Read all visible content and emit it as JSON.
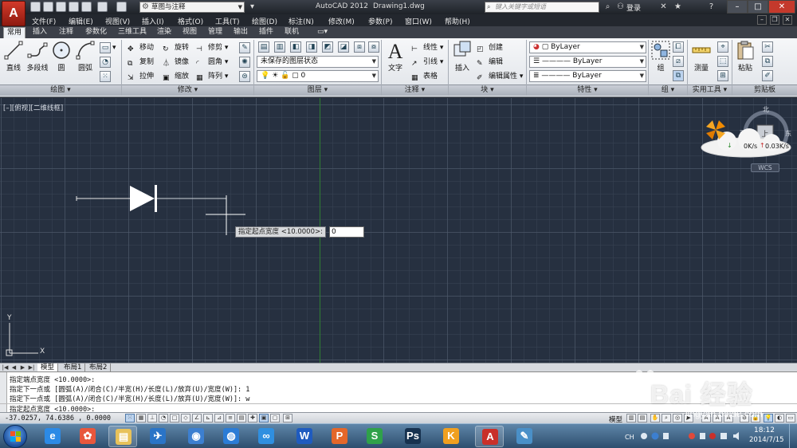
{
  "titlebar": {
    "app_logo": "A",
    "workspace": "草图与注释",
    "app_title": "AutoCAD 2012",
    "file_title": "Drawing1.dwg",
    "search_placeholder": "键入关键字或短语",
    "login": "登录",
    "minimize": "–",
    "maximize": "□",
    "close": "✕"
  },
  "menubar": {
    "items": [
      "文件(F)",
      "编辑(E)",
      "视图(V)",
      "插入(I)",
      "格式(O)",
      "工具(T)",
      "绘图(D)",
      "标注(N)",
      "修改(M)",
      "参数(P)",
      "窗口(W)",
      "帮助(H)"
    ]
  },
  "ribbon_tabs": [
    "常用",
    "插入",
    "注释",
    "参数化",
    "三维工具",
    "渲染",
    "视图",
    "管理",
    "输出",
    "插件",
    "联机"
  ],
  "ribbon": {
    "draw": {
      "title": "绘图",
      "line": "直线",
      "polyline": "多段线",
      "circle": "圆",
      "arc": "圆弧"
    },
    "modify": {
      "title": "修改",
      "move": "移动",
      "rotate": "旋转",
      "trim": "修剪",
      "copy": "复制",
      "mirror": "镜像",
      "fillet": "圆角",
      "stretch": "拉伸",
      "scale": "缩放",
      "array": "阵列"
    },
    "layers": {
      "title": "图层",
      "state": "未保存的图层状态",
      "current": "0"
    },
    "annotation": {
      "title": "注释",
      "text": "文字",
      "linear": "线性",
      "leader": "引线",
      "table": "表格"
    },
    "block": {
      "title": "块",
      "insert": "插入",
      "create": "创建",
      "edit": "编辑",
      "edit_attr": "编辑属性"
    },
    "properties": {
      "title": "特性",
      "color": "ByLayer",
      "linetype": "ByLayer",
      "lineweight": "ByLayer"
    },
    "groups": {
      "title": "组",
      "group": "组"
    },
    "utilities": {
      "title": "实用工具",
      "measure": "测量"
    },
    "clipboard": {
      "title": "剪贴板",
      "paste": "粘贴"
    }
  },
  "drawing": {
    "view_label": "[–][俯视][二维线框]",
    "prompt": "指定起点宽度 <10.0000>:",
    "input_value": "0",
    "compass": {
      "n": "北",
      "w": "西",
      "e": "东",
      "center": "上"
    },
    "wcs": "WCS",
    "net_down": "0K/s",
    "net_up": "0.03K/s",
    "ucs_y": "Y",
    "ucs_x": "X"
  },
  "layout_tabs": [
    "模型",
    "布局1",
    "布局2"
  ],
  "command_history": [
    "指定端点宽度 <10.0000>:",
    "指定下一点或 [圆弧(A)/闭合(C)/半宽(H)/长度(L)/放弃(U)/宽度(W)]: 1",
    "指定下一点或 [圆弧(A)/闭合(C)/半宽(H)/长度(L)/放弃(U)/宽度(W)]: w"
  ],
  "command_prompt": "指定起点宽度 <10.0000>:",
  "statusbar": {
    "coords": "-37.0257,  74.6386 , 0.0000",
    "model": "模型"
  },
  "taskbar": {
    "apps": [
      {
        "name": "ie",
        "glyph": "e",
        "color": "#2c8ae6"
      },
      {
        "name": "pinwheel",
        "glyph": "✿",
        "color": "#e8573d"
      },
      {
        "name": "explorer",
        "glyph": "▤",
        "color": "#e8c25a"
      },
      {
        "name": "bird",
        "glyph": "✈",
        "color": "#2a74c7"
      },
      {
        "name": "globe",
        "glyph": "◉",
        "color": "#3c7fd0"
      },
      {
        "name": "shield",
        "glyph": "◍",
        "color": "#2b7cd6"
      },
      {
        "name": "cloud",
        "glyph": "∞",
        "color": "#2f8fe0"
      },
      {
        "name": "wps-writer",
        "glyph": "W",
        "color": "#1f5bbf"
      },
      {
        "name": "wps-present",
        "glyph": "P",
        "color": "#e4672a"
      },
      {
        "name": "wps-sheet",
        "glyph": "S",
        "color": "#2fa14a"
      },
      {
        "name": "photoshop",
        "glyph": "Ps",
        "color": "#17324f"
      },
      {
        "name": "tool-k",
        "glyph": "K",
        "color": "#f0a020"
      },
      {
        "name": "autocad",
        "glyph": "A",
        "color": "#c9302a"
      },
      {
        "name": "paint",
        "glyph": "✎",
        "color": "#4a90c8"
      }
    ],
    "tray_lang": "CH",
    "time": "18:12",
    "date": "2014/7/15"
  },
  "watermark": {
    "text": "Bai 经验",
    "url": "jingyan.baidu.com"
  },
  "colors": {
    "canvas": "#263040",
    "accent_green": "#2e7d32",
    "autocad_red": "#c9302a"
  }
}
